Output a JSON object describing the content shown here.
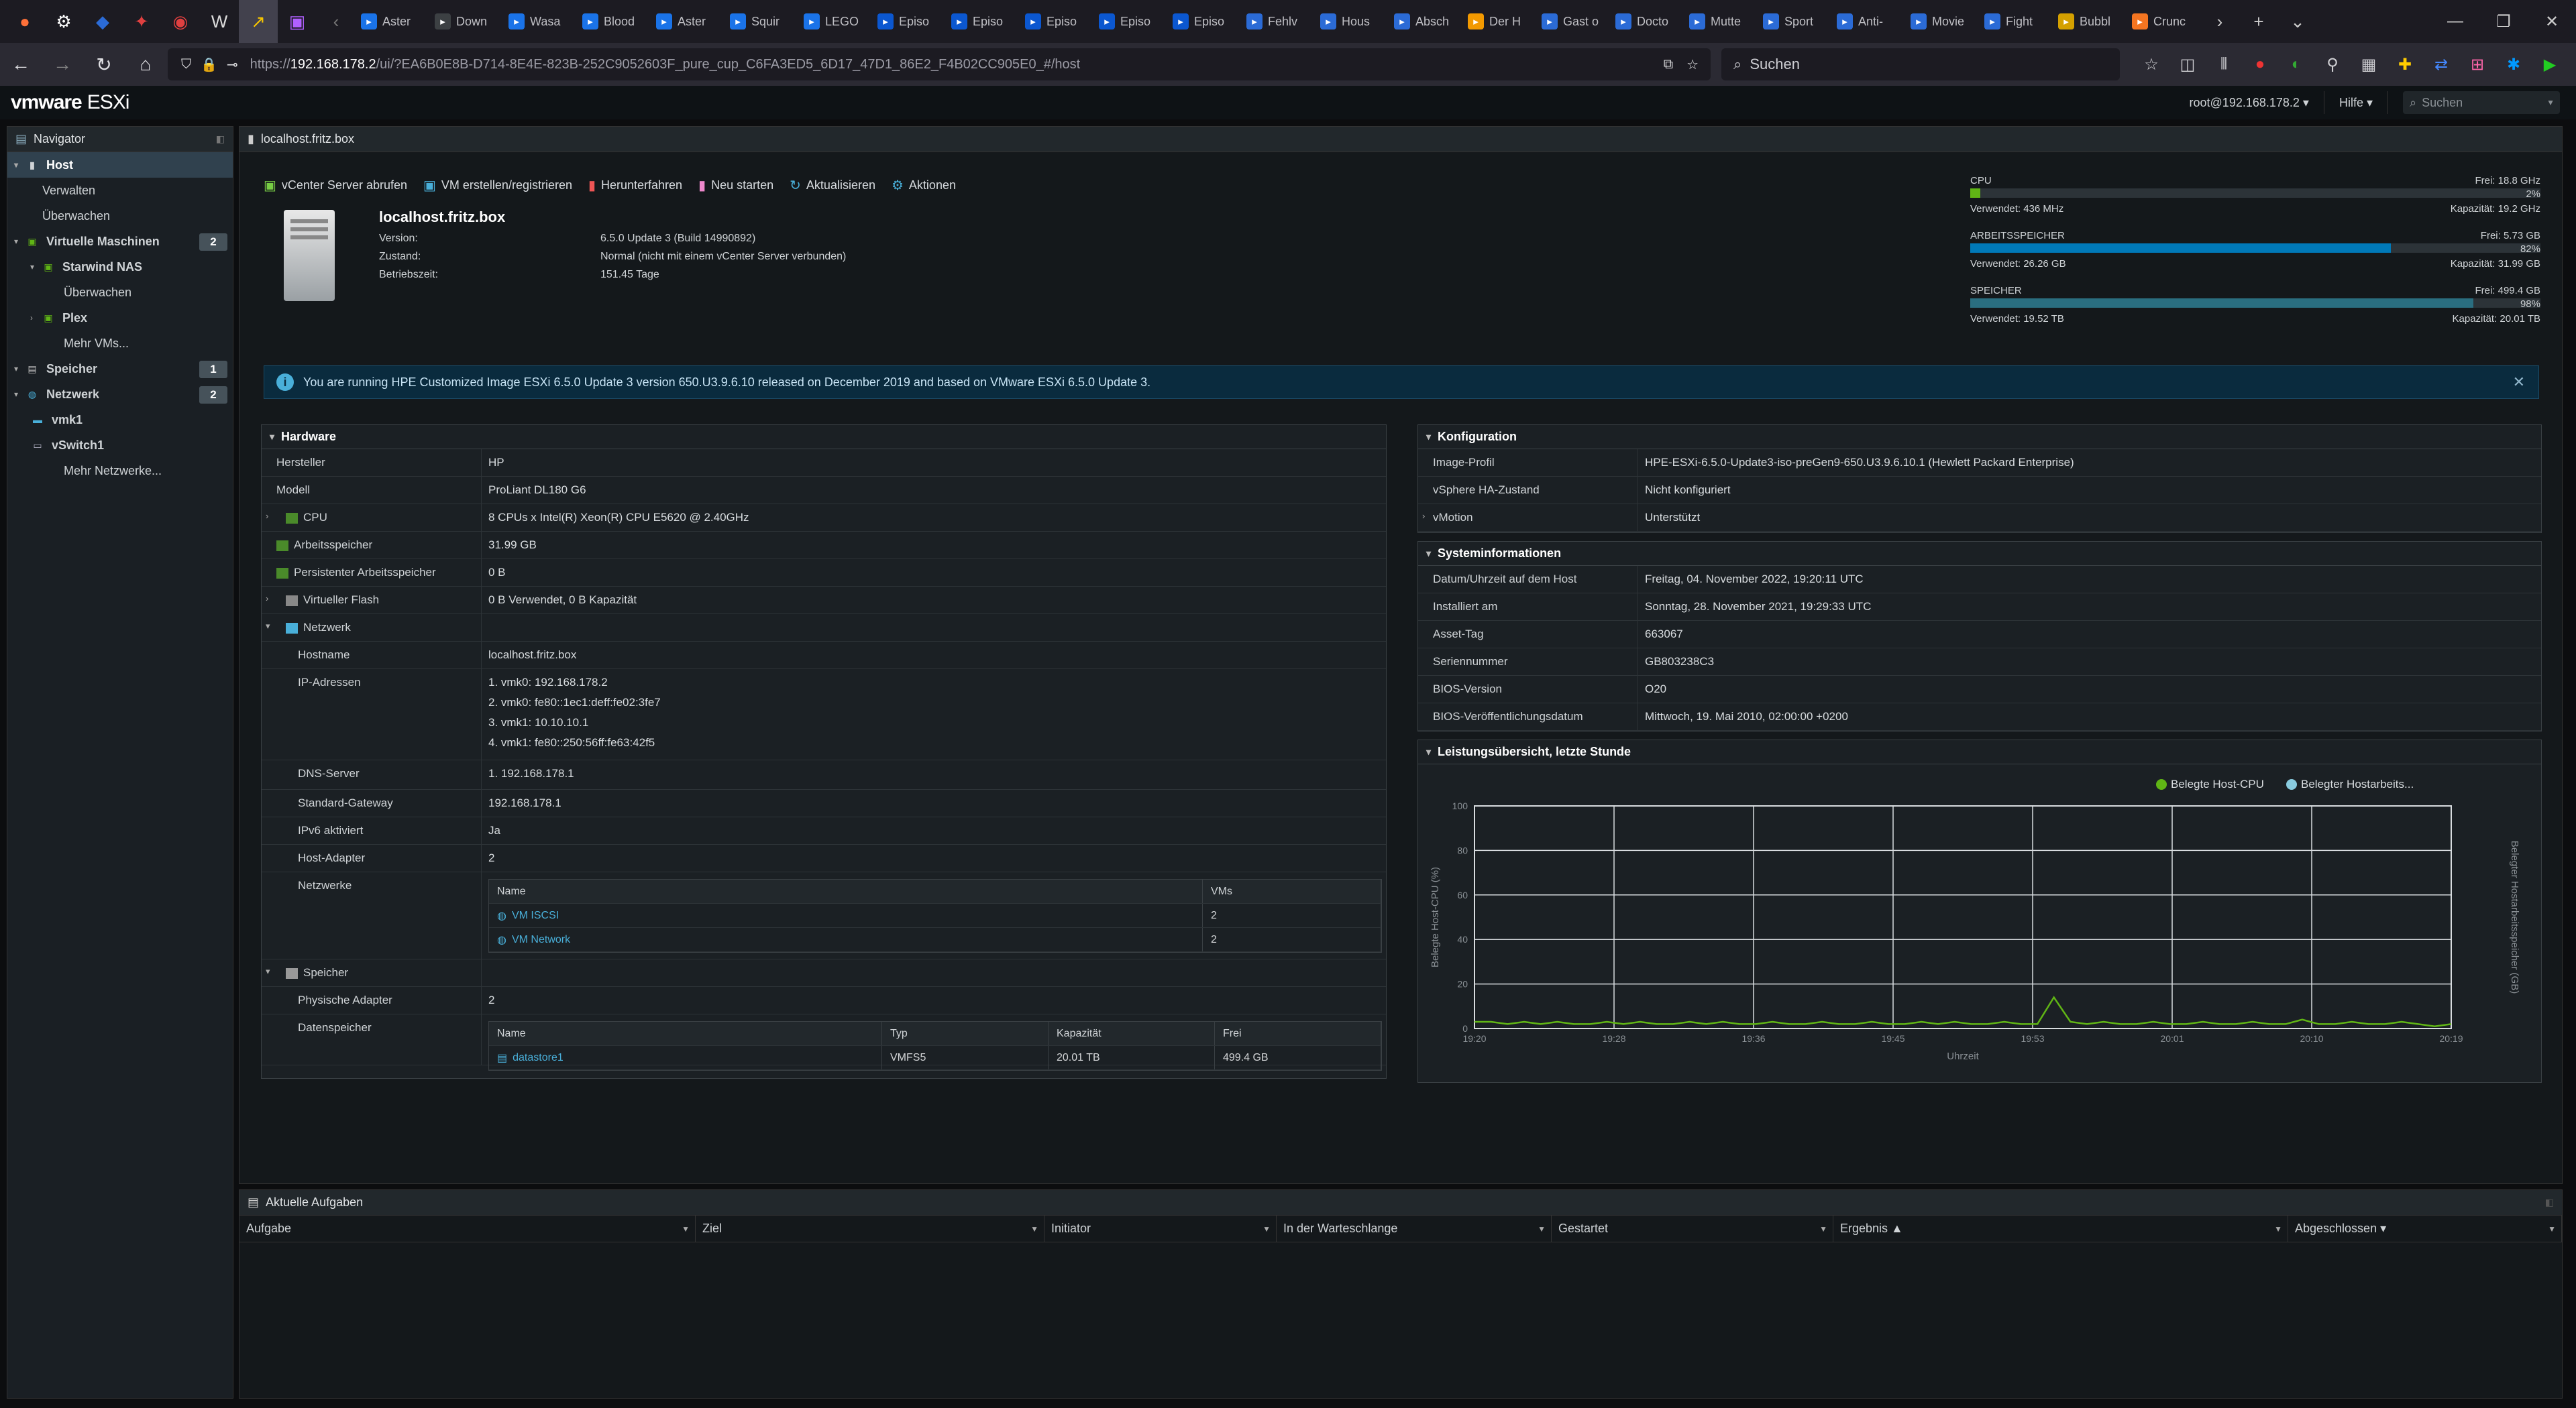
{
  "browser": {
    "tabs": [
      "Aster",
      "Down",
      "Wasa",
      "Blood",
      "Aster",
      "Squir",
      "LEGO",
      "Episo",
      "Episo",
      "Episo",
      "Episo",
      "Episo",
      "Fehlv",
      "Hous",
      "Absch",
      "Der H",
      "Gast o",
      "Docto",
      "Mutte",
      "Sport",
      "Anti-",
      "Movie",
      "Fight",
      "Bubbl",
      "Crunc"
    ],
    "url_prefix": "https://",
    "url_host": "192.168.178.2",
    "url_path": "/ui/?EA6B0E8B-D714-8E4E-823B-252C9052603F_pure_cup_C6FA3ED5_6D17_47D1_86E2_F4B02CC905E0_#/host",
    "search_placeholder": "Suchen"
  },
  "header": {
    "logo_brand": "vmware",
    "logo_product": "ESXi",
    "user": "root@192.168.178.2 ▾",
    "help": "Hilfe ▾",
    "search_placeholder": "Suchen"
  },
  "navigator": {
    "title": "Navigator",
    "items": [
      {
        "label": "Host",
        "icon": "host-icon",
        "level": 0,
        "selected": true
      },
      {
        "label": "Verwalten",
        "level": 1
      },
      {
        "label": "Überwachen",
        "level": 1
      },
      {
        "label": "Virtuelle Maschinen",
        "icon": "vm-icon",
        "level": 0,
        "count": "2"
      },
      {
        "label": "Starwind NAS",
        "icon": "vm-icon",
        "level": 1
      },
      {
        "label": "Überwachen",
        "level": 2
      },
      {
        "label": "Plex",
        "icon": "vm-icon",
        "level": 1
      },
      {
        "label": "Mehr VMs...",
        "level": 2
      },
      {
        "label": "Speicher",
        "icon": "storage-icon",
        "level": 0,
        "count": "1"
      },
      {
        "label": "Netzwerk",
        "icon": "network-icon",
        "level": 0,
        "count": "2"
      },
      {
        "label": "vmk1",
        "icon": "nic-icon",
        "level": 1
      },
      {
        "label": "vSwitch1",
        "icon": "switch-icon",
        "level": 1
      },
      {
        "label": "Mehr Netzwerke...",
        "level": 2
      }
    ]
  },
  "main": {
    "title": "localhost.fritz.box",
    "toolbar": [
      "vCenter Server abrufen",
      "VM erstellen/registrieren",
      "Herunterfahren",
      "Neu starten",
      "Aktualisieren",
      "Aktionen"
    ],
    "host": {
      "name": "localhost.fritz.box",
      "rows": [
        {
          "k": "Version:",
          "v": "6.5.0 Update 3 (Build 14990892)"
        },
        {
          "k": "Zustand:",
          "v": "Normal (nicht mit einem vCenter Server verbunden)"
        },
        {
          "k": "Betriebszeit:",
          "v": "151.45 Tage"
        }
      ]
    },
    "resources": [
      {
        "label": "CPU",
        "free": "Frei: 18.8 GHz",
        "pct": "2%",
        "pct_value": 2,
        "used": "Verwendet: 436 MHz",
        "cap": "Kapazität: 19.2 GHz"
      },
      {
        "label": "ARBEITSSPEICHER",
        "free": "Frei: 5.73 GB",
        "pct": "82%",
        "pct_value": 82,
        "used": "Verwendet: 26.26 GB",
        "cap": "Kapazität: 31.99 GB"
      },
      {
        "label": "SPEICHER",
        "free": "Frei: 499.4 GB",
        "pct": "98%",
        "pct_value": 98,
        "used": "Verwendet: 19.52 TB",
        "cap": "Kapazität: 20.01 TB"
      }
    ],
    "banner": "You are running HPE Customized Image ESXi 6.5.0 Update 3 version 650.U3.9.6.10 released on December 2019 and based on VMware ESXi 6.5.0 Update 3.",
    "hardware": {
      "title": "Hardware",
      "rows": [
        {
          "k": "Hersteller",
          "v": "HP"
        },
        {
          "k": "Modell",
          "v": "ProLiant DL180 G6"
        },
        {
          "k": "CPU",
          "v": "8 CPUs x Intel(R) Xeon(R) CPU E5620 @ 2.40GHz"
        },
        {
          "k": "Arbeitsspeicher",
          "v": "31.99 GB"
        },
        {
          "k": "Persistenter Arbeitsspeicher",
          "v": "0 B"
        },
        {
          "k": "Virtueller Flash",
          "v": "0 B Verwendet, 0 B Kapazität"
        },
        {
          "k": "Netzwerk",
          "v": ""
        },
        {
          "k": "Hostname",
          "v": "localhost.fritz.box"
        },
        {
          "k": "IP-Adressen",
          "v": [
            "1. vmk0: 192.168.178.2",
            "2. vmk0: fe80::1ec1:deff:fe02:3fe7",
            "3. vmk1: 10.10.10.1",
            "4. vmk1: fe80::250:56ff:fe63:42f5"
          ]
        },
        {
          "k": "DNS-Server",
          "v": "1. 192.168.178.1"
        },
        {
          "k": "Standard-Gateway",
          "v": "192.168.178.1"
        },
        {
          "k": "IPv6 aktiviert",
          "v": "Ja"
        },
        {
          "k": "Host-Adapter",
          "v": "2"
        },
        {
          "k": "Netzwerke",
          "v": ""
        },
        {
          "k": "Speicher",
          "v": ""
        },
        {
          "k": "Physische Adapter",
          "v": "2"
        },
        {
          "k": "Datenspeicher",
          "v": ""
        }
      ],
      "networks_table": {
        "cols": [
          "Name",
          "VMs"
        ],
        "rows": [
          [
            "VM ISCSI",
            "2"
          ],
          [
            "VM Network",
            "2"
          ]
        ]
      },
      "datastore_table": {
        "cols": [
          "Name",
          "Typ",
          "Kapazität",
          "Frei"
        ],
        "rows": [
          [
            "datastore1",
            "VMFS5",
            "20.01 TB",
            "499.4 GB"
          ]
        ]
      }
    },
    "config": {
      "title": "Konfiguration",
      "rows": [
        {
          "k": "Image-Profil",
          "v": "HPE-ESXi-6.5.0-Update3-iso-preGen9-650.U3.9.6.10.1 (Hewlett Packard Enterprise)"
        },
        {
          "k": "vSphere HA-Zustand",
          "v": "Nicht konfiguriert"
        },
        {
          "k": "vMotion",
          "v": "Unterstützt"
        }
      ]
    },
    "sysinfo": {
      "title": "Systeminformationen",
      "rows": [
        {
          "k": "Datum/Uhrzeit auf dem Host",
          "v": "Freitag, 04. November 2022, 19:20:11 UTC"
        },
        {
          "k": "Installiert am",
          "v": "Sonntag, 28. November 2021, 19:29:33 UTC"
        },
        {
          "k": "Asset-Tag",
          "v": "663067"
        },
        {
          "k": "Seriennummer",
          "v": "GB803238C3"
        },
        {
          "k": "BIOS-Version",
          "v": "O20"
        },
        {
          "k": "BIOS-Veröffentlichungsdatum",
          "v": "Mittwoch, 19. Mai 2010, 02:00:00 +0200"
        }
      ]
    },
    "performance": {
      "title": "Leistungsübersicht, letzte Stunde",
      "legend": [
        "Belegte Host-CPU",
        "Belegter Hostarbeits..."
      ],
      "xlabel": "Uhrzeit",
      "ylabel_left": "Belegte Host-CPU (%)",
      "ylabel_right": "Belegter Hostarbeitsspeicher (GB)",
      "x_ticks": [
        "19:20",
        "19:28",
        "19:36",
        "19:45",
        "19:53",
        "20:01",
        "20:10",
        "20:19"
      ],
      "y_ticks": [
        "0",
        "20",
        "40",
        "60",
        "80",
        "100"
      ],
      "cpu_series": [
        3,
        3,
        2,
        3,
        2,
        3,
        2,
        2,
        3,
        2,
        3,
        2,
        2,
        3,
        2,
        3,
        2,
        2,
        3,
        2,
        2,
        3,
        2,
        2,
        3,
        2,
        2,
        3,
        2,
        3,
        2,
        2,
        3,
        2,
        2,
        14,
        3,
        2,
        3,
        2,
        2,
        3,
        2,
        2,
        3,
        2,
        2,
        3,
        2,
        2,
        4,
        2,
        2,
        3,
        2,
        2,
        3,
        2,
        1,
        2
      ]
    }
  },
  "tasks": {
    "title": "Aktuelle Aufgaben",
    "cols": [
      "Aufgabe",
      "Ziel",
      "Initiator",
      "In der Warteschlange",
      "Gestartet",
      "Ergebnis ▲",
      "Abgeschlossen ▾"
    ]
  }
}
